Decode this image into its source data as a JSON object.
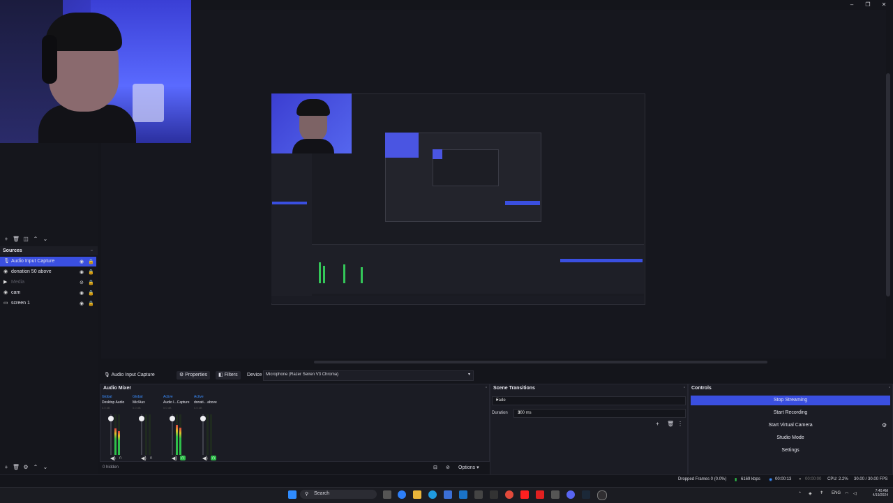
{
  "window": {
    "minimize": "–",
    "maximize": "❐",
    "close": "✕"
  },
  "sources": {
    "header": "Sources",
    "items": [
      {
        "label": "Audio Input Capture",
        "selected": true,
        "icon": "microphone-icon",
        "hidden": false
      },
      {
        "label": "donation 50 above",
        "selected": false,
        "icon": "media-icon",
        "hidden": false
      },
      {
        "label": "Media",
        "selected": false,
        "icon": "play-icon",
        "hidden": true
      },
      {
        "label": "cam",
        "selected": false,
        "icon": "camera-icon",
        "hidden": false
      },
      {
        "label": "screen 1",
        "selected": false,
        "icon": "monitor-icon",
        "hidden": false
      }
    ]
  },
  "property_bar": {
    "source_name": "Audio Input Capture",
    "properties": "Properties",
    "filters": "Filters",
    "device_label": "Device",
    "device_value": "Microphone (Razer Seiren V3 Chroma)"
  },
  "audio_mixer": {
    "title": "Audio Mixer",
    "channels": [
      {
        "top": "Global",
        "name": "Desktop Audio",
        "db": "0.0 dB",
        "level": 0.65
      },
      {
        "top": "Global",
        "name": "Mic/Aux",
        "db": "0.0 dB",
        "level": 0.0
      },
      {
        "top": "Active",
        "name": "Audio I...Capture",
        "db": "0.0 dB",
        "level": 0.75
      },
      {
        "top": "Active",
        "name": "donati... above",
        "db": "0.0 dB",
        "level": 0.0
      }
    ],
    "hidden_count": "0 hidden",
    "options_label": "Options"
  },
  "scene_transitions": {
    "title": "Scene Transitions",
    "transition": "Fade",
    "duration_label": "Duration",
    "duration_value": "300 ms"
  },
  "controls": {
    "title": "Controls",
    "buttons": [
      "Stop Streaming",
      "Start Recording",
      "Start Virtual Camera",
      "Studio Mode",
      "Settings"
    ]
  },
  "status": {
    "dropped_frames": "Dropped Frames 0 (0.0%)",
    "bitrate": "6169 kbps",
    "stream_time": "00:00:13",
    "record_time": "00:00:00",
    "cpu": "CPU: 2.2%",
    "fps": "30.00 / 30.00 FPS"
  },
  "taskbar": {
    "search": "Search",
    "lang": "ENG",
    "time": "7:40 AM",
    "date": "4/19/2024"
  },
  "colors": {
    "accent": "#3a4fe0",
    "live_green": "#2fbf4a"
  }
}
